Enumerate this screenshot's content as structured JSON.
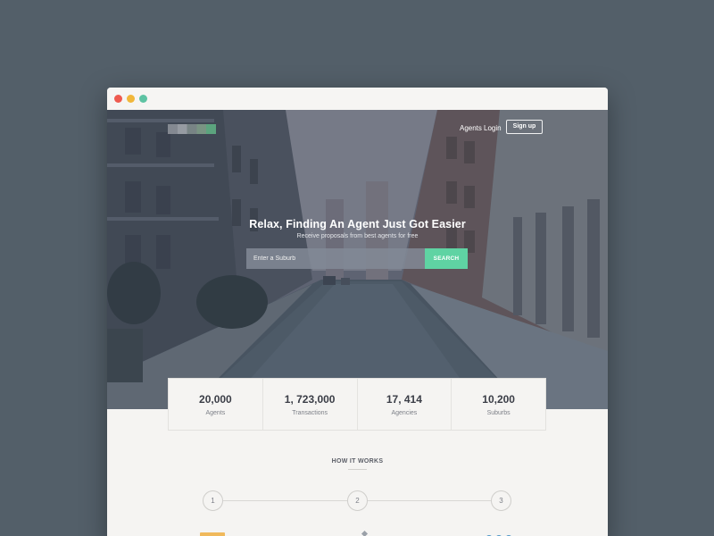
{
  "window": {
    "controls": [
      "close",
      "minimize",
      "maximize"
    ],
    "colors": {
      "close": "#ee5a4f",
      "minimize": "#f1b73a",
      "maximize": "#5ec3a3"
    }
  },
  "nav": {
    "agents": "Agents",
    "login": "Login",
    "signup": "Sign up"
  },
  "hero": {
    "title": "Relax, Finding An Agent Just Got Easier",
    "subtitle": "Receive proposals from best agents for free",
    "search_placeholder": "Enter a Suburb",
    "search_button": "SEARCH",
    "accent_color": "#5fd3a3"
  },
  "stats": [
    {
      "value": "20,000",
      "label": "Agents"
    },
    {
      "value": "1, 723,000",
      "label": "Transactions"
    },
    {
      "value": "17, 414",
      "label": "Agencies"
    },
    {
      "value": "10,200",
      "label": "Suburbs"
    }
  ],
  "how_it_works": {
    "title": "HOW IT WORKS",
    "steps": [
      "1",
      "2",
      "3"
    ]
  }
}
